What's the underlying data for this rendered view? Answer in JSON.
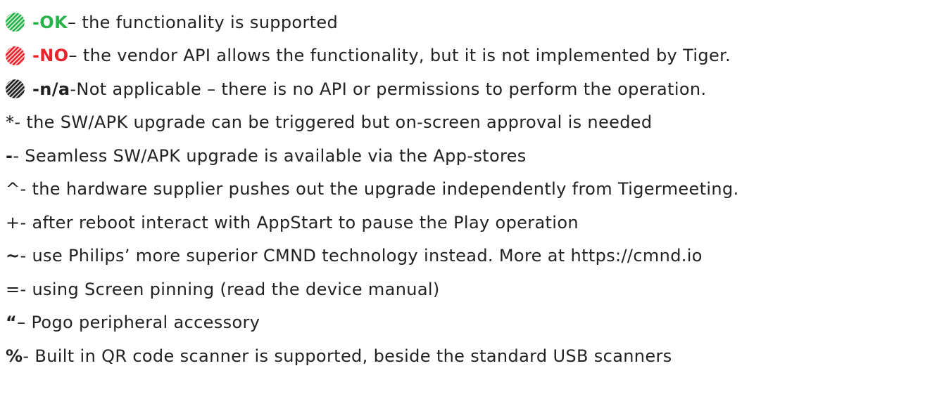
{
  "colors": {
    "ok": "#27b24a",
    "no": "#e8232c",
    "na": "#222222",
    "text": "#222222"
  },
  "status_legend": [
    {
      "icon": "ok-status-icon",
      "code": "-OK",
      "text": " – the functionality is supported"
    },
    {
      "icon": "no-status-icon",
      "code": "-NO",
      "text": " – the vendor API allows the functionality, but it is not implemented by Tiger."
    },
    {
      "icon": "na-status-icon",
      "code": "-n/a",
      "text": " -Not applicable – there is no API or permissions to perform the operation."
    }
  ],
  "symbol_legend": [
    {
      "symbol": "*",
      "text": " - the SW/APK upgrade can be triggered but on-screen approval is needed"
    },
    {
      "symbol": "-",
      "text": " - Seamless SW/APK upgrade is available via the App-stores"
    },
    {
      "symbol": "^",
      "text": " - the hardware supplier pushes out the upgrade independently from Tigermeeting."
    },
    {
      "symbol": "+",
      "text": " - after reboot interact with AppStart to pause the Play operation"
    },
    {
      "symbol": "~",
      "text": " - use Philips’ more superior CMND technology instead. More at https://cmnd.io"
    },
    {
      "symbol": "=",
      "text": " - using Screen pinning (read the device manual)"
    },
    {
      "symbol": "“",
      "text": " – Pogo peripheral accessory"
    },
    {
      "symbol": "%",
      "text": "- Built in QR code scanner is supported, beside the standard USB scanners"
    }
  ]
}
